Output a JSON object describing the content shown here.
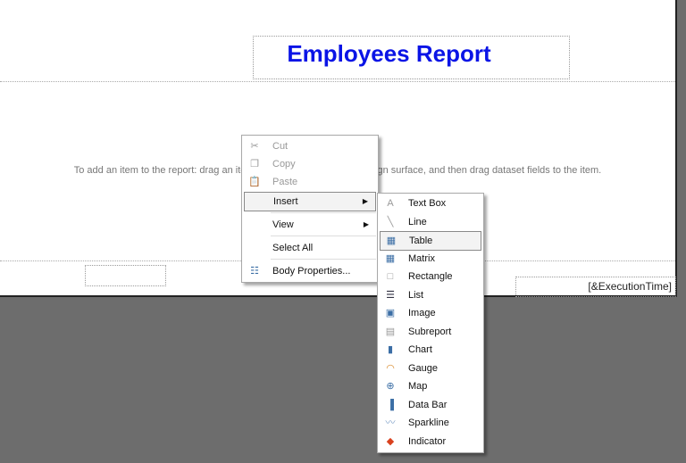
{
  "report": {
    "title": "Employees Report",
    "hint": "To add an item to the report: drag an item from the Toolbox to the design surface, and then drag dataset fields to the item.",
    "execution_time": "[&ExecutionTime]"
  },
  "context_menu": {
    "items": [
      {
        "label": "Cut",
        "icon": "cut-icon",
        "disabled": true
      },
      {
        "label": "Copy",
        "icon": "copy-icon",
        "disabled": true
      },
      {
        "label": "Paste",
        "icon": "paste-icon",
        "disabled": true
      },
      {
        "label": "Insert",
        "submenu": true,
        "selected": true
      },
      {
        "label": "View",
        "submenu": true
      },
      {
        "label": "Select All"
      },
      {
        "label": "Body Properties...",
        "icon": "properties-icon"
      }
    ]
  },
  "insert_submenu": {
    "items": [
      {
        "label": "Text Box",
        "icon": "textbox-icon"
      },
      {
        "label": "Line",
        "icon": "line-icon"
      },
      {
        "label": "Table",
        "icon": "table-icon",
        "selected": true
      },
      {
        "label": "Matrix",
        "icon": "matrix-icon"
      },
      {
        "label": "Rectangle",
        "icon": "rectangle-icon"
      },
      {
        "label": "List",
        "icon": "list-icon"
      },
      {
        "label": "Image",
        "icon": "image-icon"
      },
      {
        "label": "Subreport",
        "icon": "subreport-icon"
      },
      {
        "label": "Chart",
        "icon": "chart-icon"
      },
      {
        "label": "Gauge",
        "icon": "gauge-icon"
      },
      {
        "label": "Map",
        "icon": "map-icon"
      },
      {
        "label": "Data Bar",
        "icon": "databar-icon"
      },
      {
        "label": "Sparkline",
        "icon": "sparkline-icon"
      },
      {
        "label": "Indicator",
        "icon": "indicator-icon"
      }
    ]
  }
}
